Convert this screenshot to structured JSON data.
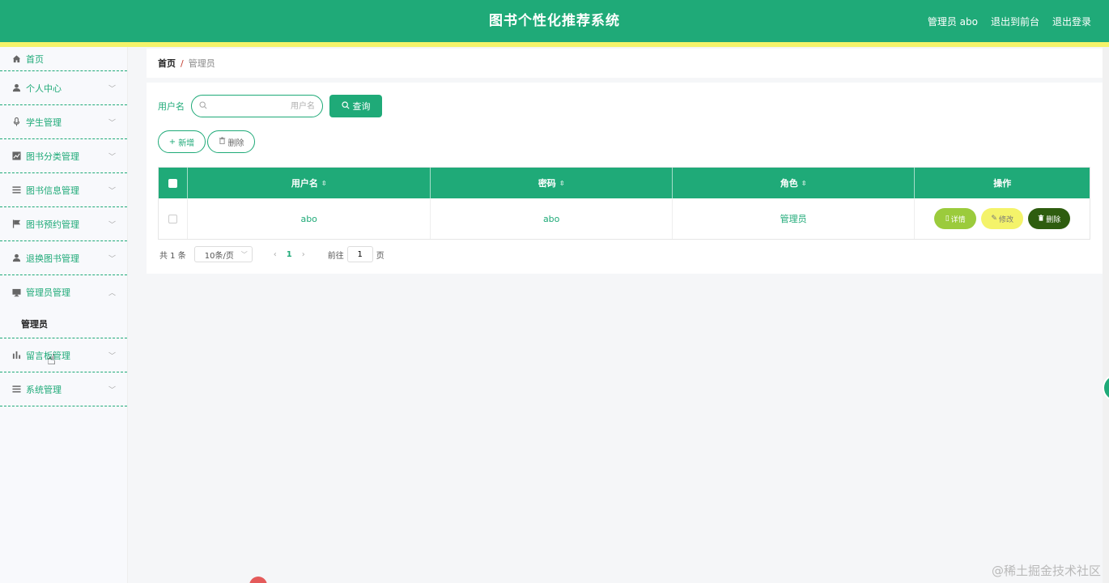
{
  "header": {
    "title": "图书个性化推荐系统",
    "admin_label": "管理员 abo",
    "to_frontend": "退出到前台",
    "logout": "退出登录"
  },
  "sidebar": {
    "items": [
      {
        "label": "首页",
        "icon": "home-icon"
      },
      {
        "label": "个人中心",
        "icon": "user-icon"
      },
      {
        "label": "学生管理",
        "icon": "microphone-icon"
      },
      {
        "label": "图书分类管理",
        "icon": "chart-icon"
      },
      {
        "label": "图书信息管理",
        "icon": "list-icon"
      },
      {
        "label": "图书预约管理",
        "icon": "flag-icon"
      },
      {
        "label": "退换图书管理",
        "icon": "user-icon"
      },
      {
        "label": "管理员管理",
        "icon": "monitor-icon"
      },
      {
        "label": "留言板管理",
        "icon": "bar-chart-icon"
      },
      {
        "label": "系统管理",
        "icon": "list-icon"
      }
    ],
    "submenu_admin": "管理员"
  },
  "breadcrumb": {
    "home": "首页",
    "separator": "/",
    "current": "管理员"
  },
  "search": {
    "label": "用户名",
    "placeholder": "用户名",
    "value": "",
    "button": "查询"
  },
  "actions": {
    "add": "新增",
    "delete": "删除"
  },
  "table": {
    "columns": [
      "用户名",
      "密码",
      "角色",
      "操作"
    ],
    "rows": [
      {
        "username": "abo",
        "password": "abo",
        "role": "管理员"
      }
    ],
    "ops": {
      "detail": "详情",
      "edit": "修改",
      "delete": "删除"
    }
  },
  "pagination": {
    "total": "共 1 条",
    "page_size": "10条/页",
    "current_page": "1",
    "goto_label": "前往",
    "goto_value": "1",
    "goto_suffix": "页"
  },
  "watermark": "@稀土掘金技术社区",
  "colors": {
    "primary": "#1faa78",
    "stripe": "#f4f36a",
    "detail_btn": "#9bcb3c",
    "edit_btn": "#f4f36a",
    "delete_btn": "#2e5d0f"
  }
}
